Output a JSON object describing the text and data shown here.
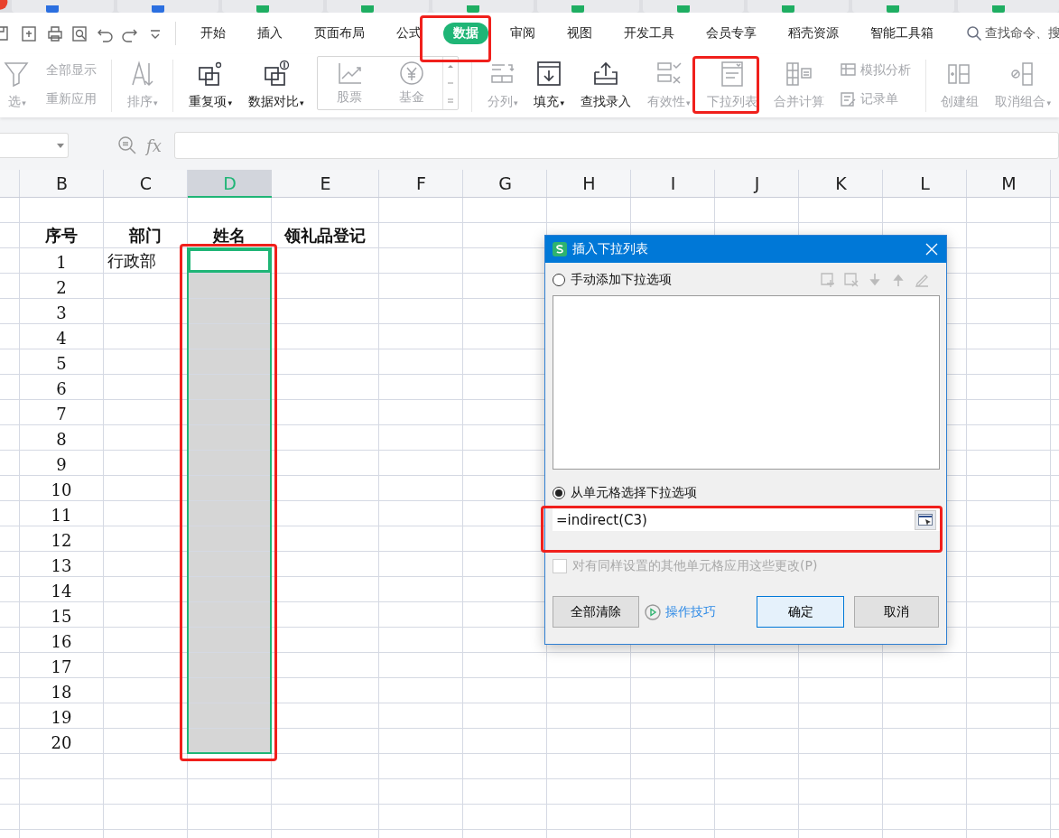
{
  "menu_tabs": [
    {
      "label": "开始",
      "selected": false
    },
    {
      "label": "插入",
      "selected": false
    },
    {
      "label": "页面布局",
      "selected": false
    },
    {
      "label": "公式",
      "selected": false
    },
    {
      "label": "数据",
      "selected": true
    },
    {
      "label": "审阅",
      "selected": false
    },
    {
      "label": "视图",
      "selected": false
    },
    {
      "label": "开发工具",
      "selected": false
    },
    {
      "label": "会员专享",
      "selected": false
    },
    {
      "label": "稻壳资源",
      "selected": false
    },
    {
      "label": "智能工具箱",
      "selected": false
    }
  ],
  "search": {
    "placeholder": "查找命令、搜"
  },
  "ribbon": [
    {
      "kind": "large",
      "label": "选",
      "caret": "▾",
      "disabled": true
    },
    {
      "kind": "stack",
      "items": [
        {
          "label": "全部显示",
          "disabled": true
        },
        {
          "label": "重新应用",
          "disabled": true
        }
      ]
    },
    {
      "kind": "sep"
    },
    {
      "kind": "large",
      "label": "排序",
      "caret": "▾",
      "disabled": true
    },
    {
      "kind": "sep"
    },
    {
      "kind": "large",
      "label": "重复项",
      "caret": "▾",
      "disabled": false
    },
    {
      "kind": "large",
      "label": "数据对比",
      "caret": "▾",
      "disabled": false
    },
    {
      "kind": "gallery",
      "items": [
        {
          "label": "股票",
          "disabled": true
        },
        {
          "label": "基金",
          "disabled": true
        }
      ]
    },
    {
      "kind": "sep"
    },
    {
      "kind": "large",
      "label": "分列",
      "caret": "▾",
      "disabled": true
    },
    {
      "kind": "large",
      "label": "填充",
      "caret": "▾",
      "disabled": false
    },
    {
      "kind": "large",
      "label": "查找录入",
      "disabled": false
    },
    {
      "kind": "large",
      "label": "有效性",
      "caret": "▾",
      "disabled": true
    },
    {
      "kind": "large",
      "label": "下拉列表",
      "disabled": true
    },
    {
      "kind": "large",
      "label": "合并计算",
      "disabled": true
    },
    {
      "kind": "stack",
      "items": [
        {
          "label": "模拟分析",
          "disabled": true
        },
        {
          "label": "记录单",
          "disabled": true
        }
      ]
    },
    {
      "kind": "sep"
    },
    {
      "kind": "large",
      "label": "创建组",
      "disabled": true
    },
    {
      "kind": "large",
      "label": "取消组合",
      "caret": "▾",
      "disabled": true
    }
  ],
  "formula_bar": {
    "fx": "fx"
  },
  "sheet": {
    "columns": [
      {
        "letter": "B",
        "selected": false
      },
      {
        "letter": "C",
        "selected": false
      },
      {
        "letter": "D",
        "selected": true
      },
      {
        "letter": "E",
        "selected": false
      },
      {
        "letter": "F",
        "selected": false
      },
      {
        "letter": "G",
        "selected": false
      },
      {
        "letter": "H",
        "selected": false
      },
      {
        "letter": "I",
        "selected": false
      },
      {
        "letter": "J",
        "selected": false
      },
      {
        "letter": "K",
        "selected": false
      },
      {
        "letter": "L",
        "selected": false
      },
      {
        "letter": "M",
        "selected": false
      }
    ],
    "rows": [
      {
        "kind": "blank",
        "cells": []
      },
      {
        "kind": "header",
        "cells": [
          "序号",
          "部门",
          "姓名",
          "领礼品登记"
        ]
      },
      {
        "kind": "data",
        "cells": [
          "1",
          "行政部"
        ],
        "selected": true,
        "active": true
      },
      {
        "kind": "data",
        "cells": [
          "2"
        ],
        "selected": true,
        "active": false
      },
      {
        "kind": "data",
        "cells": [
          "3"
        ],
        "selected": true,
        "active": false
      },
      {
        "kind": "data",
        "cells": [
          "4"
        ],
        "selected": true,
        "active": false
      },
      {
        "kind": "data",
        "cells": [
          "5"
        ],
        "selected": true,
        "active": false
      },
      {
        "kind": "data",
        "cells": [
          "6"
        ],
        "selected": true,
        "active": false
      },
      {
        "kind": "data",
        "cells": [
          "7"
        ],
        "selected": true,
        "active": false
      },
      {
        "kind": "data",
        "cells": [
          "8"
        ],
        "selected": true,
        "active": false
      },
      {
        "kind": "data",
        "cells": [
          "9"
        ],
        "selected": true,
        "active": false
      },
      {
        "kind": "data",
        "cells": [
          "10"
        ],
        "selected": true,
        "active": false
      },
      {
        "kind": "data",
        "cells": [
          "11"
        ],
        "selected": true,
        "active": false
      },
      {
        "kind": "data",
        "cells": [
          "12"
        ],
        "selected": true,
        "active": false
      },
      {
        "kind": "data",
        "cells": [
          "13"
        ],
        "selected": true,
        "active": false
      },
      {
        "kind": "data",
        "cells": [
          "14"
        ],
        "selected": true,
        "active": false
      },
      {
        "kind": "data",
        "cells": [
          "15"
        ],
        "selected": true,
        "active": false
      },
      {
        "kind": "data",
        "cells": [
          "16"
        ],
        "selected": true,
        "active": false
      },
      {
        "kind": "data",
        "cells": [
          "17"
        ],
        "selected": true,
        "active": false
      },
      {
        "kind": "data",
        "cells": [
          "18"
        ],
        "selected": true,
        "active": false
      },
      {
        "kind": "data",
        "cells": [
          "19"
        ],
        "selected": true,
        "active": false
      },
      {
        "kind": "data",
        "cells": [
          "20"
        ],
        "selected": true,
        "active": false
      }
    ]
  },
  "dialog": {
    "title": "插入下拉列表",
    "options": [
      {
        "label": "手动添加下拉选项",
        "selected": false
      },
      {
        "label": "从单元格选择下拉选项",
        "selected": true
      }
    ],
    "source": {
      "value": "=indirect(C3)"
    },
    "apply_all": {
      "label": "对有同样设置的其他单元格应用这些更改(P)",
      "checked": false,
      "disabled": true
    },
    "buttons": [
      {
        "label": "全部清除",
        "kind": "plain"
      },
      {
        "label": "操作技巧",
        "kind": "link"
      },
      {
        "label": "确定",
        "kind": "default"
      },
      {
        "label": "取消",
        "kind": "plain"
      }
    ]
  }
}
